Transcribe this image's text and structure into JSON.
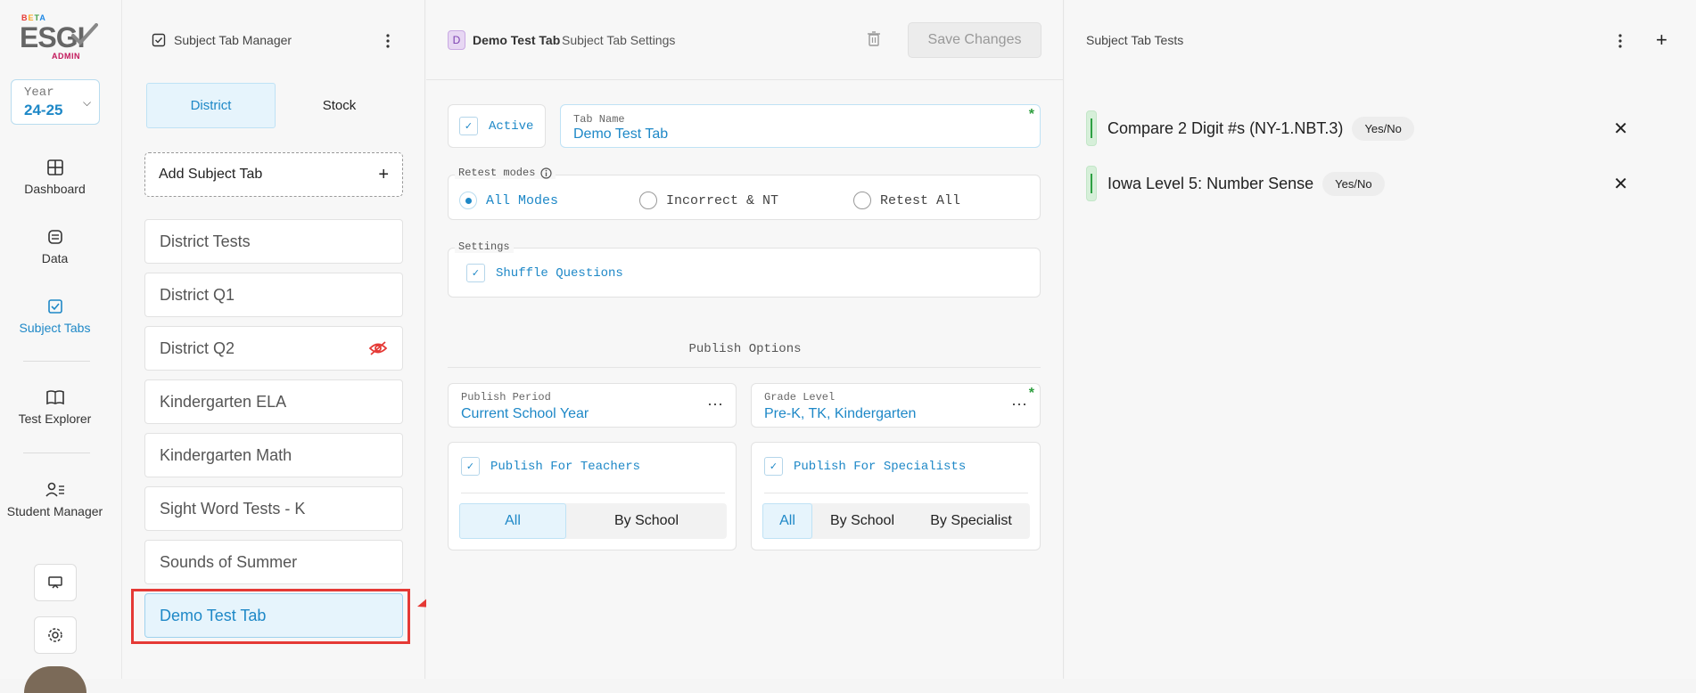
{
  "brand": {
    "beta": "BETA",
    "name": "ESGI",
    "admin": "ADMIN"
  },
  "year": {
    "label": "Year",
    "value": "24-25"
  },
  "nav": {
    "dashboard": "Dashboard",
    "data": "Data",
    "subject_tabs": "Subject Tabs",
    "test_explorer": "Test Explorer",
    "student_manager": "Student Manager"
  },
  "tab_manager": {
    "title": "Subject Tab Manager",
    "segments": [
      "District",
      "Stock"
    ],
    "add_label": "Add Subject Tab",
    "tabs": [
      {
        "label": "District Tests",
        "hidden": false
      },
      {
        "label": "District Q1",
        "hidden": false
      },
      {
        "label": "District Q2",
        "hidden": true
      },
      {
        "label": "Kindergarten ELA",
        "hidden": false
      },
      {
        "label": "Kindergarten Math",
        "hidden": false
      },
      {
        "label": "Sight Word Tests - K",
        "hidden": false
      },
      {
        "label": "Sounds of Summer",
        "hidden": false
      },
      {
        "label": "Demo Test Tab",
        "hidden": false,
        "selected": true
      }
    ]
  },
  "settings": {
    "badge": "D",
    "tab_title": "Demo Test Tab",
    "subtitle": "Subject Tab Settings",
    "save_label": "Save Changes",
    "active_label": "Active",
    "tab_name_label": "Tab Name",
    "tab_name_value": "Demo Test Tab",
    "retest_label": "Retest modes",
    "retest_options": [
      "All Modes",
      "Incorrect & NT",
      "Retest All"
    ],
    "settings_label": "Settings",
    "shuffle_label": "Shuffle Questions",
    "publish_options": "Publish Options",
    "publish_period_label": "Publish Period",
    "publish_period_value": "Current School Year",
    "grade_level_label": "Grade Level",
    "grade_level_value": "Pre-K, TK, Kindergarten",
    "publish_teachers": "Publish For Teachers",
    "publish_specialists": "Publish For Specialists",
    "teachers_seg": [
      "All",
      "By School"
    ],
    "specialists_seg": [
      "All",
      "By School",
      "By Specialist"
    ]
  },
  "tests": {
    "title": "Subject Tab Tests",
    "items": [
      {
        "name": "Compare 2 Digit #s (NY-1.NBT.3)",
        "type": "Yes/No"
      },
      {
        "name": "Iowa Level 5: Number Sense",
        "type": "Yes/No"
      }
    ]
  },
  "colors": {
    "accent": "#1e88c7",
    "highlight": "#e53935",
    "required": "#2e9e3f"
  }
}
